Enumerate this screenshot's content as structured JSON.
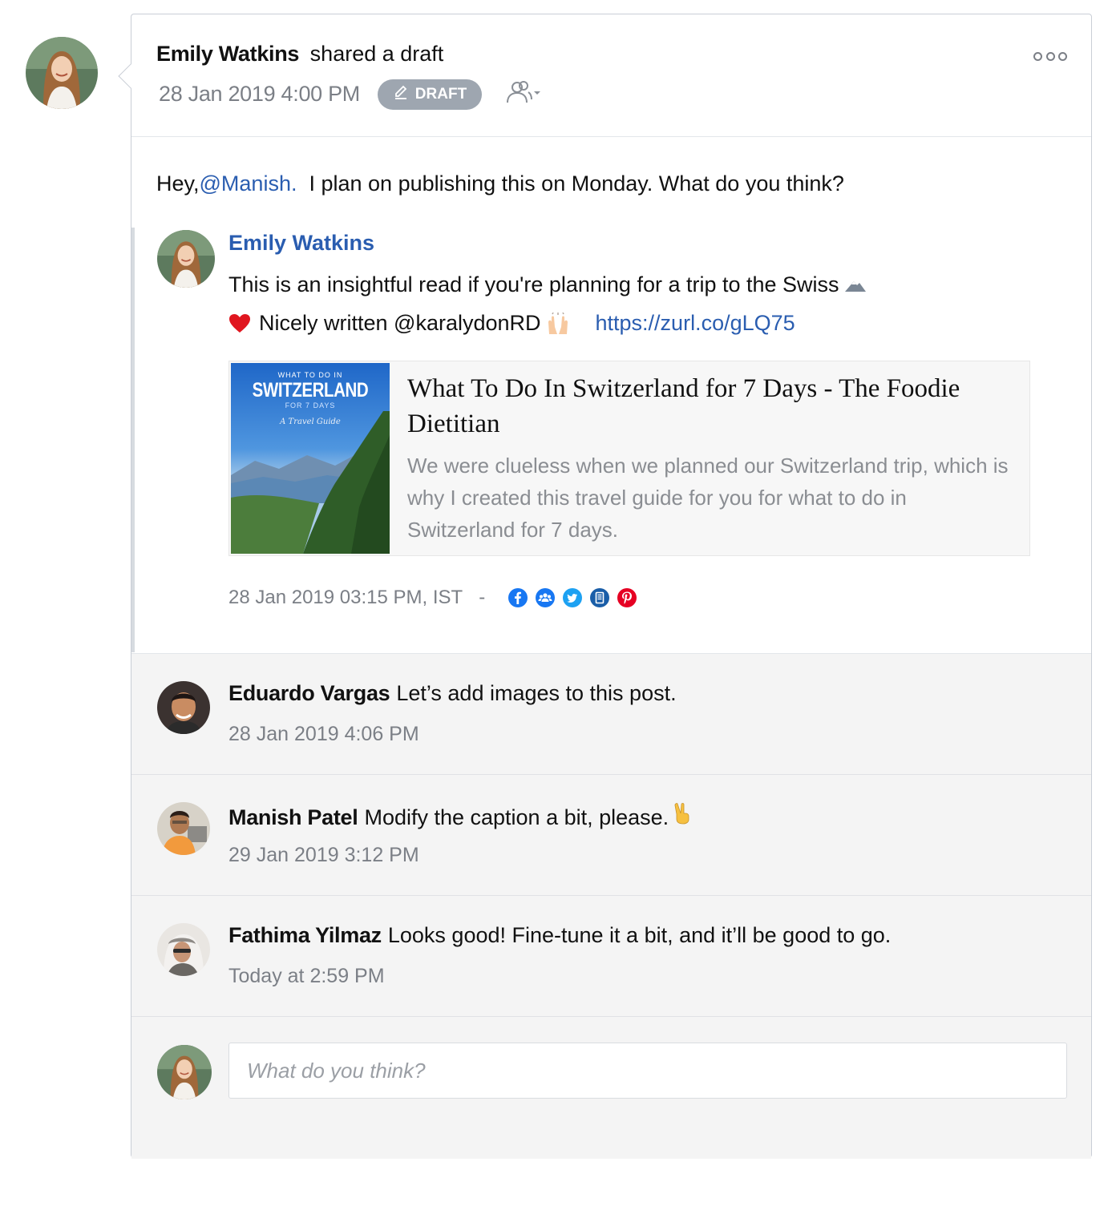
{
  "post": {
    "author": "Emily Watkins",
    "action": "shared a draft",
    "date": "28 Jan 2019 4:00 PM",
    "status_badge": "DRAFT",
    "message_prefix": "Hey,",
    "mention": "@Manish.",
    "message_suffix": "I plan on publishing this on Monday. What do you think?"
  },
  "shared_post": {
    "author": "Emily Watkins",
    "text_line1": "This is an insightful read if you're planning for a trip to the Swiss",
    "text_line2": "Nicely written @karalydonRD",
    "link": "https://zurl.co/gLQ75",
    "preview": {
      "thumb_line1": "WHAT TO DO IN",
      "thumb_line2": "SWITZERLAND",
      "thumb_line3": "FOR 7 DAYS",
      "thumb_line4": "A Travel Guide",
      "title": "What To Do In Switzerland for 7 Days - The Foodie Dietitian",
      "description": "We were clueless when we planned our Switzerland trip, which is why I created this travel guide for you for what to do in Switzerland for 7 days."
    },
    "scheduled": "28 Jan 2019 03:15 PM, IST",
    "separator": "-",
    "channels": [
      "facebook-icon",
      "facebook-groups-icon",
      "twitter-icon",
      "google-my-business-icon",
      "pinterest-icon"
    ]
  },
  "comments": [
    {
      "name": "Eduardo Vargas",
      "text": "Let’s add images to this post.",
      "time": "28 Jan 2019 4:06 PM"
    },
    {
      "name": "Manish Patel",
      "text": "Modify the caption a bit, please.",
      "time": "29 Jan 2019 3:12 PM"
    },
    {
      "name": "Fathima Yilmaz",
      "text": "Looks good! Fine-tune it a bit, and it’ll be good to go.",
      "time": "Today at 2:59 PM"
    }
  ],
  "reply": {
    "placeholder": "What do you think?"
  },
  "colors": {
    "link_blue": "#2a5db0",
    "badge_gray": "#9ea6b0",
    "facebook": "#1877f2",
    "twitter": "#1da1f2",
    "pinterest": "#e60023",
    "gmb": "#1a73e8"
  }
}
